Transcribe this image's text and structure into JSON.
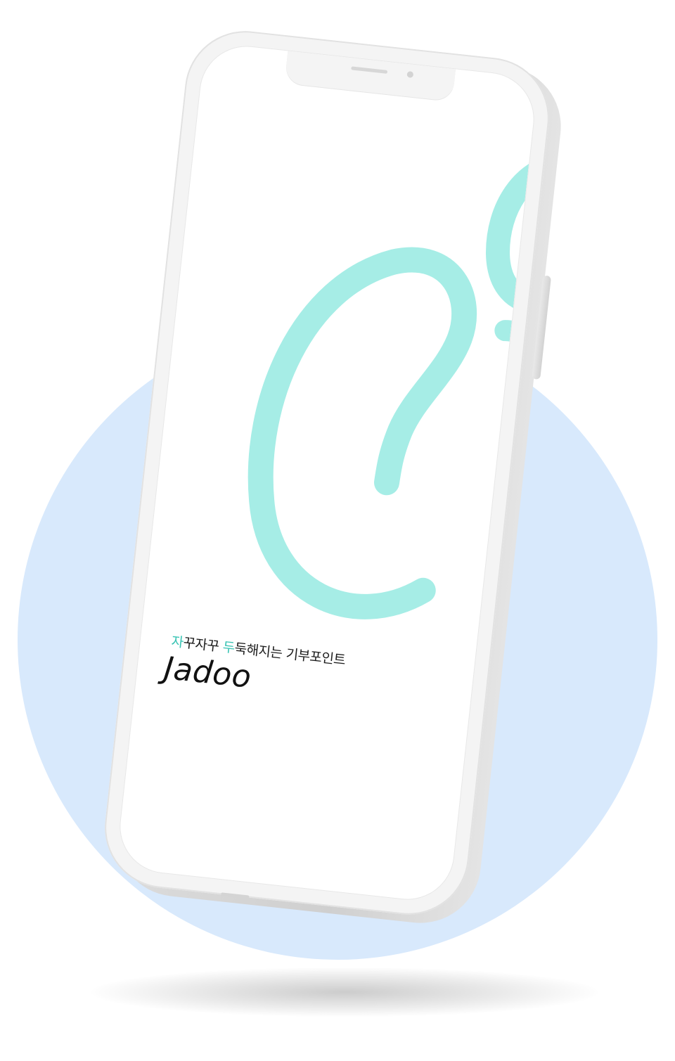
{
  "splash": {
    "tagline": {
      "part1_highlight": "자",
      "part1_rest": "꾸자꾸 ",
      "part2_highlight": "두",
      "part2_rest": "둑해지는 기부포인트"
    },
    "brand_name": "Jadoo"
  },
  "colors": {
    "background_circle": "#d8e9fc",
    "logo_mint": "#a6ede6",
    "highlight_teal": "#37c3b3",
    "phone_frame": "#f4f4f4",
    "text_dark": "#111111"
  },
  "icons": {
    "logo_mark": "jadoo-swirl-logo-icon"
  }
}
